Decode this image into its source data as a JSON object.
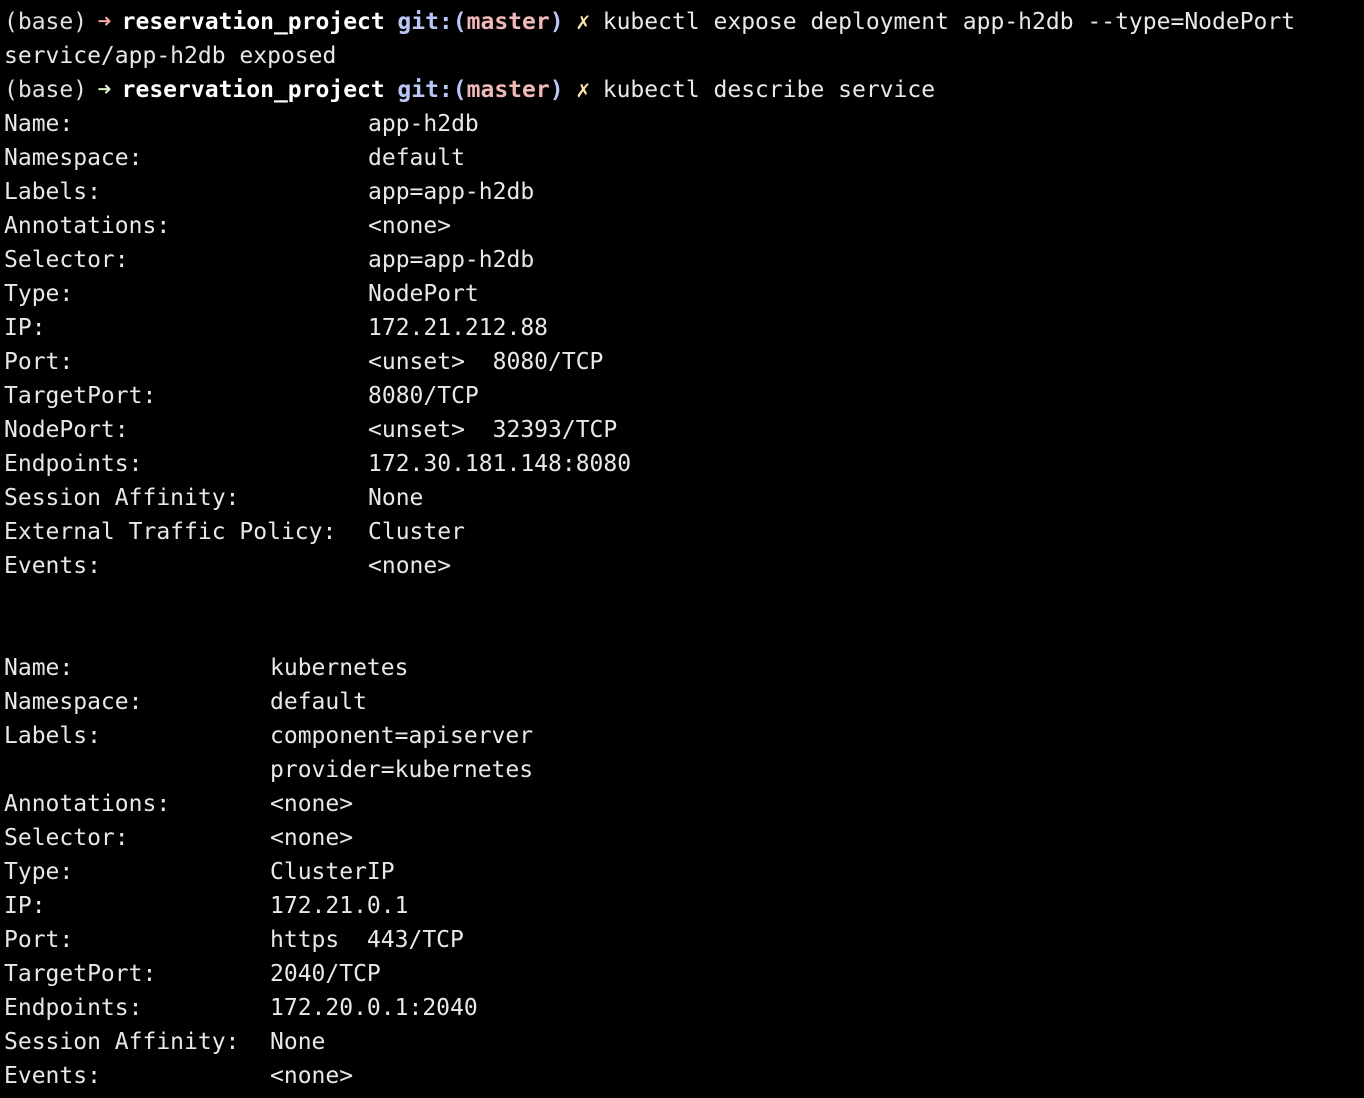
{
  "prompts": [
    {
      "env": "(base)",
      "arrow": "➜",
      "dir": "reservation_project",
      "git_prefix": "git:(",
      "branch": "master",
      "git_suffix": ")",
      "dirty": "✗",
      "command": "kubectl expose deployment app-h2db --type=NodePort"
    },
    {
      "env": "(base)",
      "arrow": "➜",
      "dir": "reservation_project",
      "git_prefix": "git:(",
      "branch": "master",
      "git_suffix": ")",
      "dirty": "✗",
      "command": "kubectl describe service"
    }
  ],
  "expose_output": "service/app-h2db exposed",
  "service1": [
    {
      "key": "Name:",
      "value": "app-h2db"
    },
    {
      "key": "Namespace:",
      "value": "default"
    },
    {
      "key": "Labels:",
      "value": "app=app-h2db"
    },
    {
      "key": "Annotations:",
      "value": "<none>"
    },
    {
      "key": "Selector:",
      "value": "app=app-h2db"
    },
    {
      "key": "Type:",
      "value": "NodePort"
    },
    {
      "key": "IP:",
      "value": "172.21.212.88"
    },
    {
      "key": "Port:",
      "value": "<unset>  8080/TCP"
    },
    {
      "key": "TargetPort:",
      "value": "8080/TCP"
    },
    {
      "key": "NodePort:",
      "value": "<unset>  32393/TCP"
    },
    {
      "key": "Endpoints:",
      "value": "172.30.181.148:8080"
    },
    {
      "key": "Session Affinity:",
      "value": "None"
    },
    {
      "key": "External Traffic Policy:",
      "value": "Cluster"
    },
    {
      "key": "Events:",
      "value": "<none>"
    }
  ],
  "service2": [
    {
      "key": "Name:",
      "value": "kubernetes"
    },
    {
      "key": "Namespace:",
      "value": "default"
    },
    {
      "key": "Labels:",
      "value": "component=apiserver"
    },
    {
      "key": "",
      "value": "provider=kubernetes"
    },
    {
      "key": "Annotations:",
      "value": "<none>"
    },
    {
      "key": "Selector:",
      "value": "<none>"
    },
    {
      "key": "Type:",
      "value": "ClusterIP"
    },
    {
      "key": "IP:",
      "value": "172.21.0.1"
    },
    {
      "key": "Port:",
      "value": "https  443/TCP"
    },
    {
      "key": "TargetPort:",
      "value": "2040/TCP"
    },
    {
      "key": "Endpoints:",
      "value": "172.20.0.1:2040"
    },
    {
      "key": "Session Affinity:",
      "value": "None"
    },
    {
      "key": "Events:",
      "value": "<none>"
    }
  ]
}
